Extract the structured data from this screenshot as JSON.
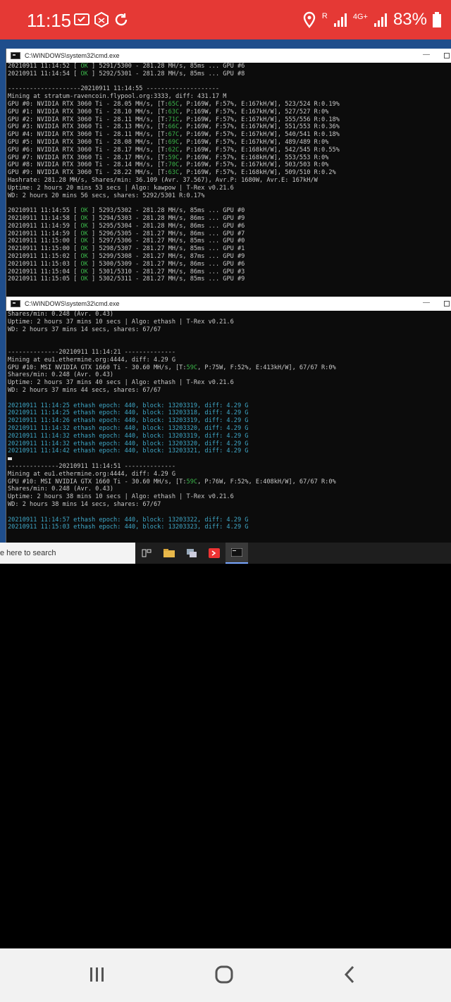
{
  "status": {
    "time": "11:15",
    "battery": "83%",
    "network": "4G+",
    "roaming": "R"
  },
  "window1": {
    "title": "C:\\WINDOWS\\system32\\cmd.exe",
    "lines": [
      {
        "d": "20210911 11:14:52",
        "ok": "OK",
        "rest": " 5291/5300 - 281.28 MH/s, 85ms ... GPU #6"
      },
      {
        "d": "20210911 11:14:54",
        "ok": "OK",
        "rest": " 5292/5301 - 281.28 MH/s, 85ms ... GPU #8"
      },
      {
        "t": ""
      },
      {
        "t": "--------------------20210911 11:14:55 --------------------"
      },
      {
        "t": "Mining at stratum-ravencoin.flypool.org:3333, diff: 431.17 M"
      },
      {
        "gpu": "GPU #0: NVIDIA RTX 3060 Ti - 28.05 MH/s, [T:",
        "temp": "65C",
        "tail": ", P:169W, F:57%, E:167kH/W], 523/524 R:0.19%"
      },
      {
        "gpu": "GPU #1: NVIDIA RTX 3060 Ti - 28.10 MH/s, [T:",
        "temp": "63C",
        "tail": ", P:169W, F:57%, E:167kH/W], 527/527 R:0%"
      },
      {
        "gpu": "GPU #2: NVIDIA RTX 3060 Ti - 28.11 MH/s, [T:",
        "temp": "71C",
        "tail": ", P:169W, F:57%, E:167kH/W], 555/556 R:0.18%"
      },
      {
        "gpu": "GPU #3: NVIDIA RTX 3060 Ti - 28.13 MH/s, [T:",
        "temp": "66C",
        "tail": ", P:169W, F:57%, E:167kH/W], 551/553 R:0.36%"
      },
      {
        "gpu": "GPU #4: NVIDIA RTX 3060 Ti - 28.11 MH/s, [T:",
        "temp": "67C",
        "tail": ", P:169W, F:57%, E:167kH/W], 540/541 R:0.18%"
      },
      {
        "gpu": "GPU #5: NVIDIA RTX 3060 Ti - 28.08 MH/s, [T:",
        "temp": "69C",
        "tail": ", P:169W, F:57%, E:167kH/W], 489/489 R:0%"
      },
      {
        "gpu": "GPU #6: NVIDIA RTX 3060 Ti - 28.17 MH/s, [T:",
        "temp": "62C",
        "tail": ", P:169W, F:57%, E:168kH/W], 542/545 R:0.55%"
      },
      {
        "gpu": "GPU #7: NVIDIA RTX 3060 Ti - 28.17 MH/s, [T:",
        "temp": "59C",
        "tail": ", P:169W, F:57%, E:168kH/W], 553/553 R:0%"
      },
      {
        "gpu": "GPU #8: NVIDIA RTX 3060 Ti - 28.14 MH/s, [T:",
        "temp": "70C",
        "tail": ", P:169W, F:57%, E:167kH/W], 503/503 R:0%"
      },
      {
        "gpu": "GPU #9: NVIDIA RTX 3060 Ti - 28.22 MH/s, [T:",
        "temp": "63C",
        "tail": ", P:169W, F:57%, E:168kH/W], 509/510 R:0.2%"
      },
      {
        "t": "Hashrate: 281.28 MH/s, Shares/min: 36.109 (Avr. 37.567), Avr.P: 1680W, Avr.E: 167kH/W"
      },
      {
        "t": "Uptime: 2 hours 20 mins 53 secs | Algo: kawpow | T-Rex v0.21.6"
      },
      {
        "t": "WD: 2 hours 20 mins 56 secs, shares: 5292/5301 R:0.17%"
      },
      {
        "t": ""
      },
      {
        "d": "20210911 11:14:55",
        "ok": "OK",
        "rest": " 5293/5302 - 281.28 MH/s, 85ms ... GPU #0"
      },
      {
        "d": "20210911 11:14:58",
        "ok": "OK",
        "rest": " 5294/5303 - 281.28 MH/s, 86ms ... GPU #9"
      },
      {
        "d": "20210911 11:14:59",
        "ok": "OK",
        "rest": " 5295/5304 - 281.28 MH/s, 86ms ... GPU #6"
      },
      {
        "d": "20210911 11:14:59",
        "ok": "OK",
        "rest": " 5296/5305 - 281.27 MH/s, 86ms ... GPU #7"
      },
      {
        "d": "20210911 11:15:00",
        "ok": "OK",
        "rest": " 5297/5306 - 281.27 MH/s, 85ms ... GPU #0"
      },
      {
        "d": "20210911 11:15:00",
        "ok": "OK",
        "rest": " 5298/5307 - 281.27 MH/s, 85ms ... GPU #1"
      },
      {
        "d": "20210911 11:15:02",
        "ok": "OK",
        "rest": " 5299/5308 - 281.27 MH/s, 87ms ... GPU #9"
      },
      {
        "d": "20210911 11:15:03",
        "ok": "OK",
        "rest": " 5300/5309 - 281.27 MH/s, 86ms ... GPU #6"
      },
      {
        "d": "20210911 11:15:04",
        "ok": "OK",
        "rest": " 5301/5310 - 281.27 MH/s, 86ms ... GPU #3"
      },
      {
        "d": "20210911 11:15:05",
        "ok": "OK",
        "rest": " 5302/5311 - 281.27 MH/s, 85ms ... GPU #9"
      }
    ]
  },
  "window2": {
    "title": "C:\\WINDOWS\\system32\\cmd.exe",
    "lines": [
      {
        "t": "Shares/min: 0.248 (Avr. 0.43)"
      },
      {
        "t": "Uptime: 2 hours 37 mins 10 secs | Algo: ethash | T-Rex v0.21.6"
      },
      {
        "t": "WD: 2 hours 37 mins 14 secs, shares: 67/67"
      },
      {
        "t": ""
      },
      {
        "t": ""
      },
      {
        "t": "--------------20210911 11:14:21 --------------"
      },
      {
        "t": "Mining at eu1.ethermine.org:4444, diff: 4.29 G"
      },
      {
        "gpu": "GPU #10: MSI NVIDIA GTX 1660 Ti - 30.60 MH/s, [T:",
        "temp": "59C",
        "tail": ", P:75W, F:52%, E:413kH/W], 67/67 R:0%"
      },
      {
        "t": "Shares/min: 0.248 (Avr. 0.43)"
      },
      {
        "t": "Uptime: 2 hours 37 mins 40 secs | Algo: ethash | T-Rex v0.21.6"
      },
      {
        "t": "WD: 2 hours 37 mins 44 secs, shares: 67/67"
      },
      {
        "t": ""
      },
      {
        "c": "20210911 11:14:25 ethash epoch: 440, block: 13203319, diff: 4.29 G"
      },
      {
        "c": "20210911 11:14:25 ethash epoch: 440, block: 13203318, diff: 4.29 G"
      },
      {
        "c": "20210911 11:14:26 ethash epoch: 440, block: 13203319, diff: 4.29 G"
      },
      {
        "c": "20210911 11:14:32 ethash epoch: 440, block: 13203320, diff: 4.29 G"
      },
      {
        "c": "20210911 11:14:32 ethash epoch: 440, block: 13203319, diff: 4.29 G"
      },
      {
        "c": "20210911 11:14:32 ethash epoch: 440, block: 13203320, diff: 4.29 G"
      },
      {
        "c": "20210911 11:14:42 ethash epoch: 440, block: 13203321, diff: 4.29 G"
      },
      {
        "cursor": true
      },
      {
        "t": "--------------20210911 11:14:51 --------------"
      },
      {
        "t": "Mining at eu1.ethermine.org:4444, diff: 4.29 G"
      },
      {
        "gpu": "GPU #10: MSI NVIDIA GTX 1660 Ti - 30.60 MH/s, [T:",
        "temp": "59C",
        "tail": ", P:76W, F:52%, E:408kH/W], 67/67 R:0%"
      },
      {
        "t": "Shares/min: 0.248 (Avr. 0.43)"
      },
      {
        "t": "Uptime: 2 hours 38 mins 10 secs | Algo: ethash | T-Rex v0.21.6"
      },
      {
        "t": "WD: 2 hours 38 mins 14 secs, shares: 67/67"
      },
      {
        "t": ""
      },
      {
        "c": "20210911 11:14:57 ethash epoch: 440, block: 13203322, diff: 4.29 G"
      },
      {
        "c": "20210911 11:15:03 ethash epoch: 440, block: 13203323, diff: 4.29 G"
      }
    ]
  },
  "taskbar": {
    "search_text": "e here to search"
  },
  "colors": {
    "statusbar": "#e53935",
    "ok_green": "#3bb54a",
    "ethash_cyan": "#3fa8c8"
  }
}
